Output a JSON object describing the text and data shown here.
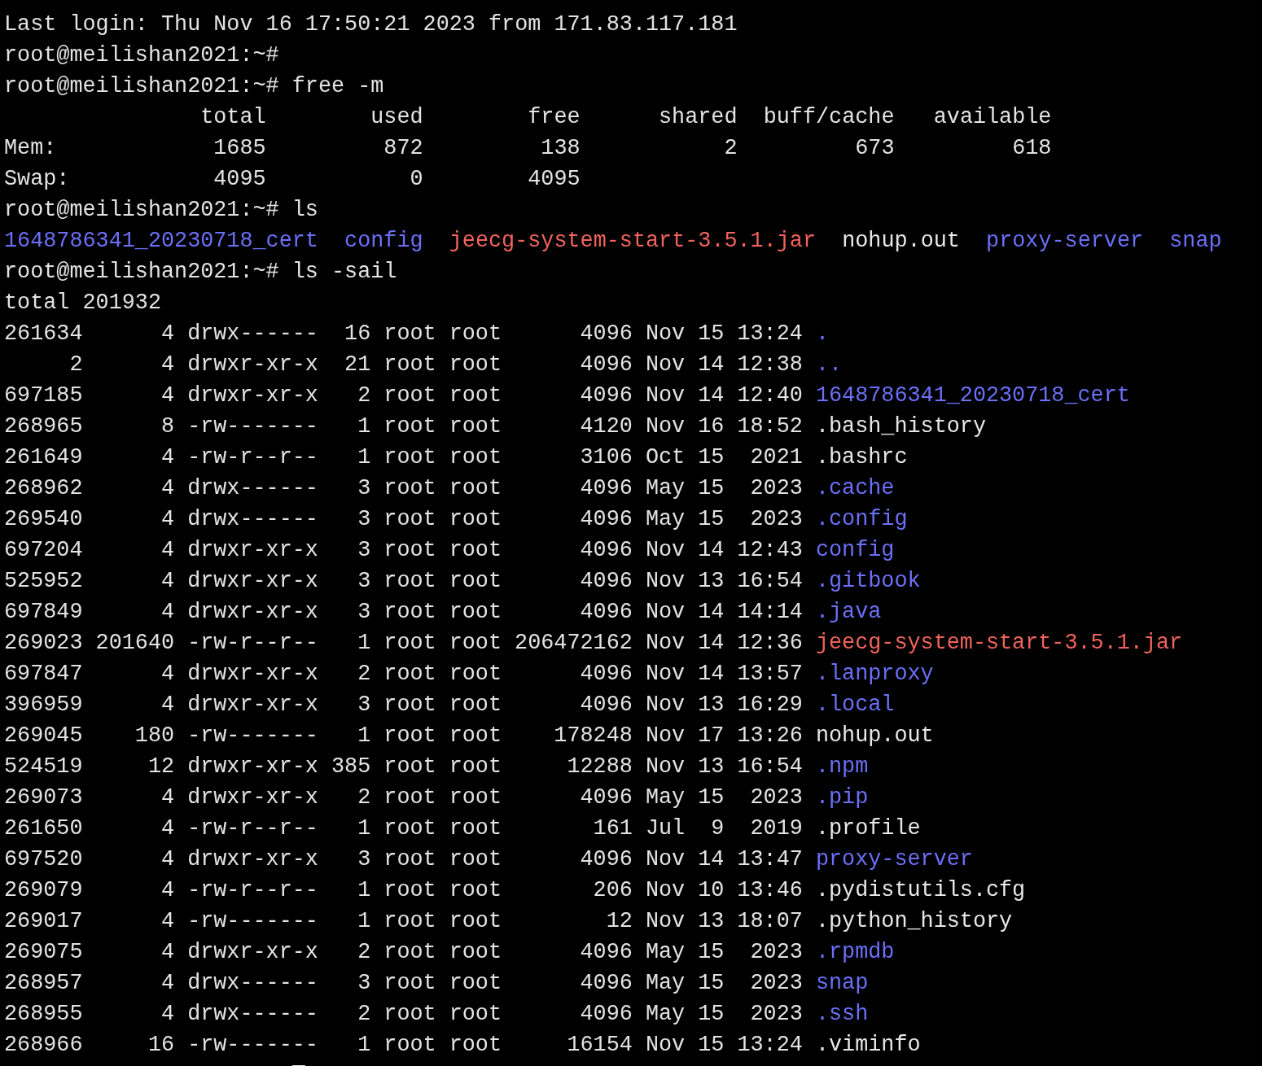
{
  "terminal": {
    "blocks": [
      {
        "kind": "text",
        "text": "Last login: Thu Nov 16 17:50:21 2023 from 171.83.117.181"
      },
      {
        "kind": "prompt",
        "prompt": "root@meilishan2021:~#"
      },
      {
        "kind": "prompt",
        "prompt": "root@meilishan2021:~#",
        "command": "free -m"
      },
      {
        "kind": "free",
        "columns": [
          "total",
          "used",
          "free",
          "shared",
          "buff/cache",
          "available"
        ],
        "rows": [
          {
            "label": "Mem:",
            "cells": [
              "1685",
              "872",
              "138",
              "2",
              "673",
              "618"
            ]
          },
          {
            "label": "Swap:",
            "cells": [
              "4095",
              "0",
              "4095"
            ]
          }
        ]
      },
      {
        "kind": "prompt",
        "prompt": "root@meilishan2021:~#",
        "command": "ls"
      },
      {
        "kind": "ls_short",
        "items": [
          {
            "name": "1648786341_20230718_cert",
            "color": "#6b70f7"
          },
          {
            "name": "config",
            "color": "#6b70f7"
          },
          {
            "name": "jeecg-system-start-3.5.1.jar",
            "color": "#f0645c"
          },
          {
            "name": "nohup.out",
            "color": "#e8e8e8"
          },
          {
            "name": "proxy-server",
            "color": "#6b70f7"
          },
          {
            "name": "snap",
            "color": "#6b70f7"
          }
        ]
      },
      {
        "kind": "prompt",
        "prompt": "root@meilishan2021:~#",
        "command": "ls -sail"
      },
      {
        "kind": "text",
        "text": "total 201932"
      },
      {
        "kind": "ls_long",
        "rows": [
          {
            "inode": "261634",
            "blocks": "4",
            "mode": "drwx------",
            "links": "16",
            "owner": "root",
            "group": "root",
            "size": "4096",
            "month": "Nov",
            "day": "15",
            "time": "13:24",
            "name": ".",
            "color": "#6b70f7"
          },
          {
            "inode": "2",
            "blocks": "4",
            "mode": "drwxr-xr-x",
            "links": "21",
            "owner": "root",
            "group": "root",
            "size": "4096",
            "month": "Nov",
            "day": "14",
            "time": "12:38",
            "name": "..",
            "color": "#6b70f7"
          },
          {
            "inode": "697185",
            "blocks": "4",
            "mode": "drwxr-xr-x",
            "links": "2",
            "owner": "root",
            "group": "root",
            "size": "4096",
            "month": "Nov",
            "day": "14",
            "time": "12:40",
            "name": "1648786341_20230718_cert",
            "color": "#6b70f7"
          },
          {
            "inode": "268965",
            "blocks": "8",
            "mode": "-rw-------",
            "links": "1",
            "owner": "root",
            "group": "root",
            "size": "4120",
            "month": "Nov",
            "day": "16",
            "time": "18:52",
            "name": ".bash_history",
            "color": "#e8e8e8"
          },
          {
            "inode": "261649",
            "blocks": "4",
            "mode": "-rw-r--r--",
            "links": "1",
            "owner": "root",
            "group": "root",
            "size": "3106",
            "month": "Oct",
            "day": "15",
            "time": "2021",
            "name": ".bashrc",
            "color": "#e8e8e8"
          },
          {
            "inode": "268962",
            "blocks": "4",
            "mode": "drwx------",
            "links": "3",
            "owner": "root",
            "group": "root",
            "size": "4096",
            "month": "May",
            "day": "15",
            "time": "2023",
            "name": ".cache",
            "color": "#6b70f7"
          },
          {
            "inode": "269540",
            "blocks": "4",
            "mode": "drwx------",
            "links": "3",
            "owner": "root",
            "group": "root",
            "size": "4096",
            "month": "May",
            "day": "15",
            "time": "2023",
            "name": ".config",
            "color": "#6b70f7"
          },
          {
            "inode": "697204",
            "blocks": "4",
            "mode": "drwxr-xr-x",
            "links": "3",
            "owner": "root",
            "group": "root",
            "size": "4096",
            "month": "Nov",
            "day": "14",
            "time": "12:43",
            "name": "config",
            "color": "#6b70f7"
          },
          {
            "inode": "525952",
            "blocks": "4",
            "mode": "drwxr-xr-x",
            "links": "3",
            "owner": "root",
            "group": "root",
            "size": "4096",
            "month": "Nov",
            "day": "13",
            "time": "16:54",
            "name": ".gitbook",
            "color": "#6b70f7"
          },
          {
            "inode": "697849",
            "blocks": "4",
            "mode": "drwxr-xr-x",
            "links": "3",
            "owner": "root",
            "group": "root",
            "size": "4096",
            "month": "Nov",
            "day": "14",
            "time": "14:14",
            "name": ".java",
            "color": "#6b70f7"
          },
          {
            "inode": "269023",
            "blocks": "201640",
            "mode": "-rw-r--r--",
            "links": "1",
            "owner": "root",
            "group": "root",
            "size": "206472162",
            "month": "Nov",
            "day": "14",
            "time": "12:36",
            "name": "jeecg-system-start-3.5.1.jar",
            "color": "#f0645c"
          },
          {
            "inode": "697847",
            "blocks": "4",
            "mode": "drwxr-xr-x",
            "links": "2",
            "owner": "root",
            "group": "root",
            "size": "4096",
            "month": "Nov",
            "day": "14",
            "time": "13:57",
            "name": ".lanproxy",
            "color": "#6b70f7"
          },
          {
            "inode": "396959",
            "blocks": "4",
            "mode": "drwxr-xr-x",
            "links": "3",
            "owner": "root",
            "group": "root",
            "size": "4096",
            "month": "Nov",
            "day": "13",
            "time": "16:29",
            "name": ".local",
            "color": "#6b70f7"
          },
          {
            "inode": "269045",
            "blocks": "180",
            "mode": "-rw-------",
            "links": "1",
            "owner": "root",
            "group": "root",
            "size": "178248",
            "month": "Nov",
            "day": "17",
            "time": "13:26",
            "name": "nohup.out",
            "color": "#e8e8e8"
          },
          {
            "inode": "524519",
            "blocks": "12",
            "mode": "drwxr-xr-x",
            "links": "385",
            "owner": "root",
            "group": "root",
            "size": "12288",
            "month": "Nov",
            "day": "13",
            "time": "16:54",
            "name": ".npm",
            "color": "#6b70f7"
          },
          {
            "inode": "269073",
            "blocks": "4",
            "mode": "drwxr-xr-x",
            "links": "2",
            "owner": "root",
            "group": "root",
            "size": "4096",
            "month": "May",
            "day": "15",
            "time": "2023",
            "name": ".pip",
            "color": "#6b70f7"
          },
          {
            "inode": "261650",
            "blocks": "4",
            "mode": "-rw-r--r--",
            "links": "1",
            "owner": "root",
            "group": "root",
            "size": "161",
            "month": "Jul",
            "day": "9",
            "time": "2019",
            "name": ".profile",
            "color": "#e8e8e8"
          },
          {
            "inode": "697520",
            "blocks": "4",
            "mode": "drwxr-xr-x",
            "links": "3",
            "owner": "root",
            "group": "root",
            "size": "4096",
            "month": "Nov",
            "day": "14",
            "time": "13:47",
            "name": "proxy-server",
            "color": "#6b70f7"
          },
          {
            "inode": "269079",
            "blocks": "4",
            "mode": "-rw-r--r--",
            "links": "1",
            "owner": "root",
            "group": "root",
            "size": "206",
            "month": "Nov",
            "day": "10",
            "time": "13:46",
            "name": ".pydistutils.cfg",
            "color": "#e8e8e8"
          },
          {
            "inode": "269017",
            "blocks": "4",
            "mode": "-rw-------",
            "links": "1",
            "owner": "root",
            "group": "root",
            "size": "12",
            "month": "Nov",
            "day": "13",
            "time": "18:07",
            "name": ".python_history",
            "color": "#e8e8e8"
          },
          {
            "inode": "269075",
            "blocks": "4",
            "mode": "drwxr-xr-x",
            "links": "2",
            "owner": "root",
            "group": "root",
            "size": "4096",
            "month": "May",
            "day": "15",
            "time": "2023",
            "name": ".rpmdb",
            "color": "#6b70f7"
          },
          {
            "inode": "268957",
            "blocks": "4",
            "mode": "drwx------",
            "links": "3",
            "owner": "root",
            "group": "root",
            "size": "4096",
            "month": "May",
            "day": "15",
            "time": "2023",
            "name": "snap",
            "color": "#6b70f7"
          },
          {
            "inode": "268955",
            "blocks": "4",
            "mode": "drwx------",
            "links": "2",
            "owner": "root",
            "group": "root",
            "size": "4096",
            "month": "May",
            "day": "15",
            "time": "2023",
            "name": ".ssh",
            "color": "#6b70f7"
          },
          {
            "inode": "268966",
            "blocks": "16",
            "mode": "-rw-------",
            "links": "1",
            "owner": "root",
            "group": "root",
            "size": "16154",
            "month": "Nov",
            "day": "15",
            "time": "13:24",
            "name": ".viminfo",
            "color": "#e8e8e8"
          }
        ]
      },
      {
        "kind": "cursor",
        "visible": true
      }
    ]
  }
}
